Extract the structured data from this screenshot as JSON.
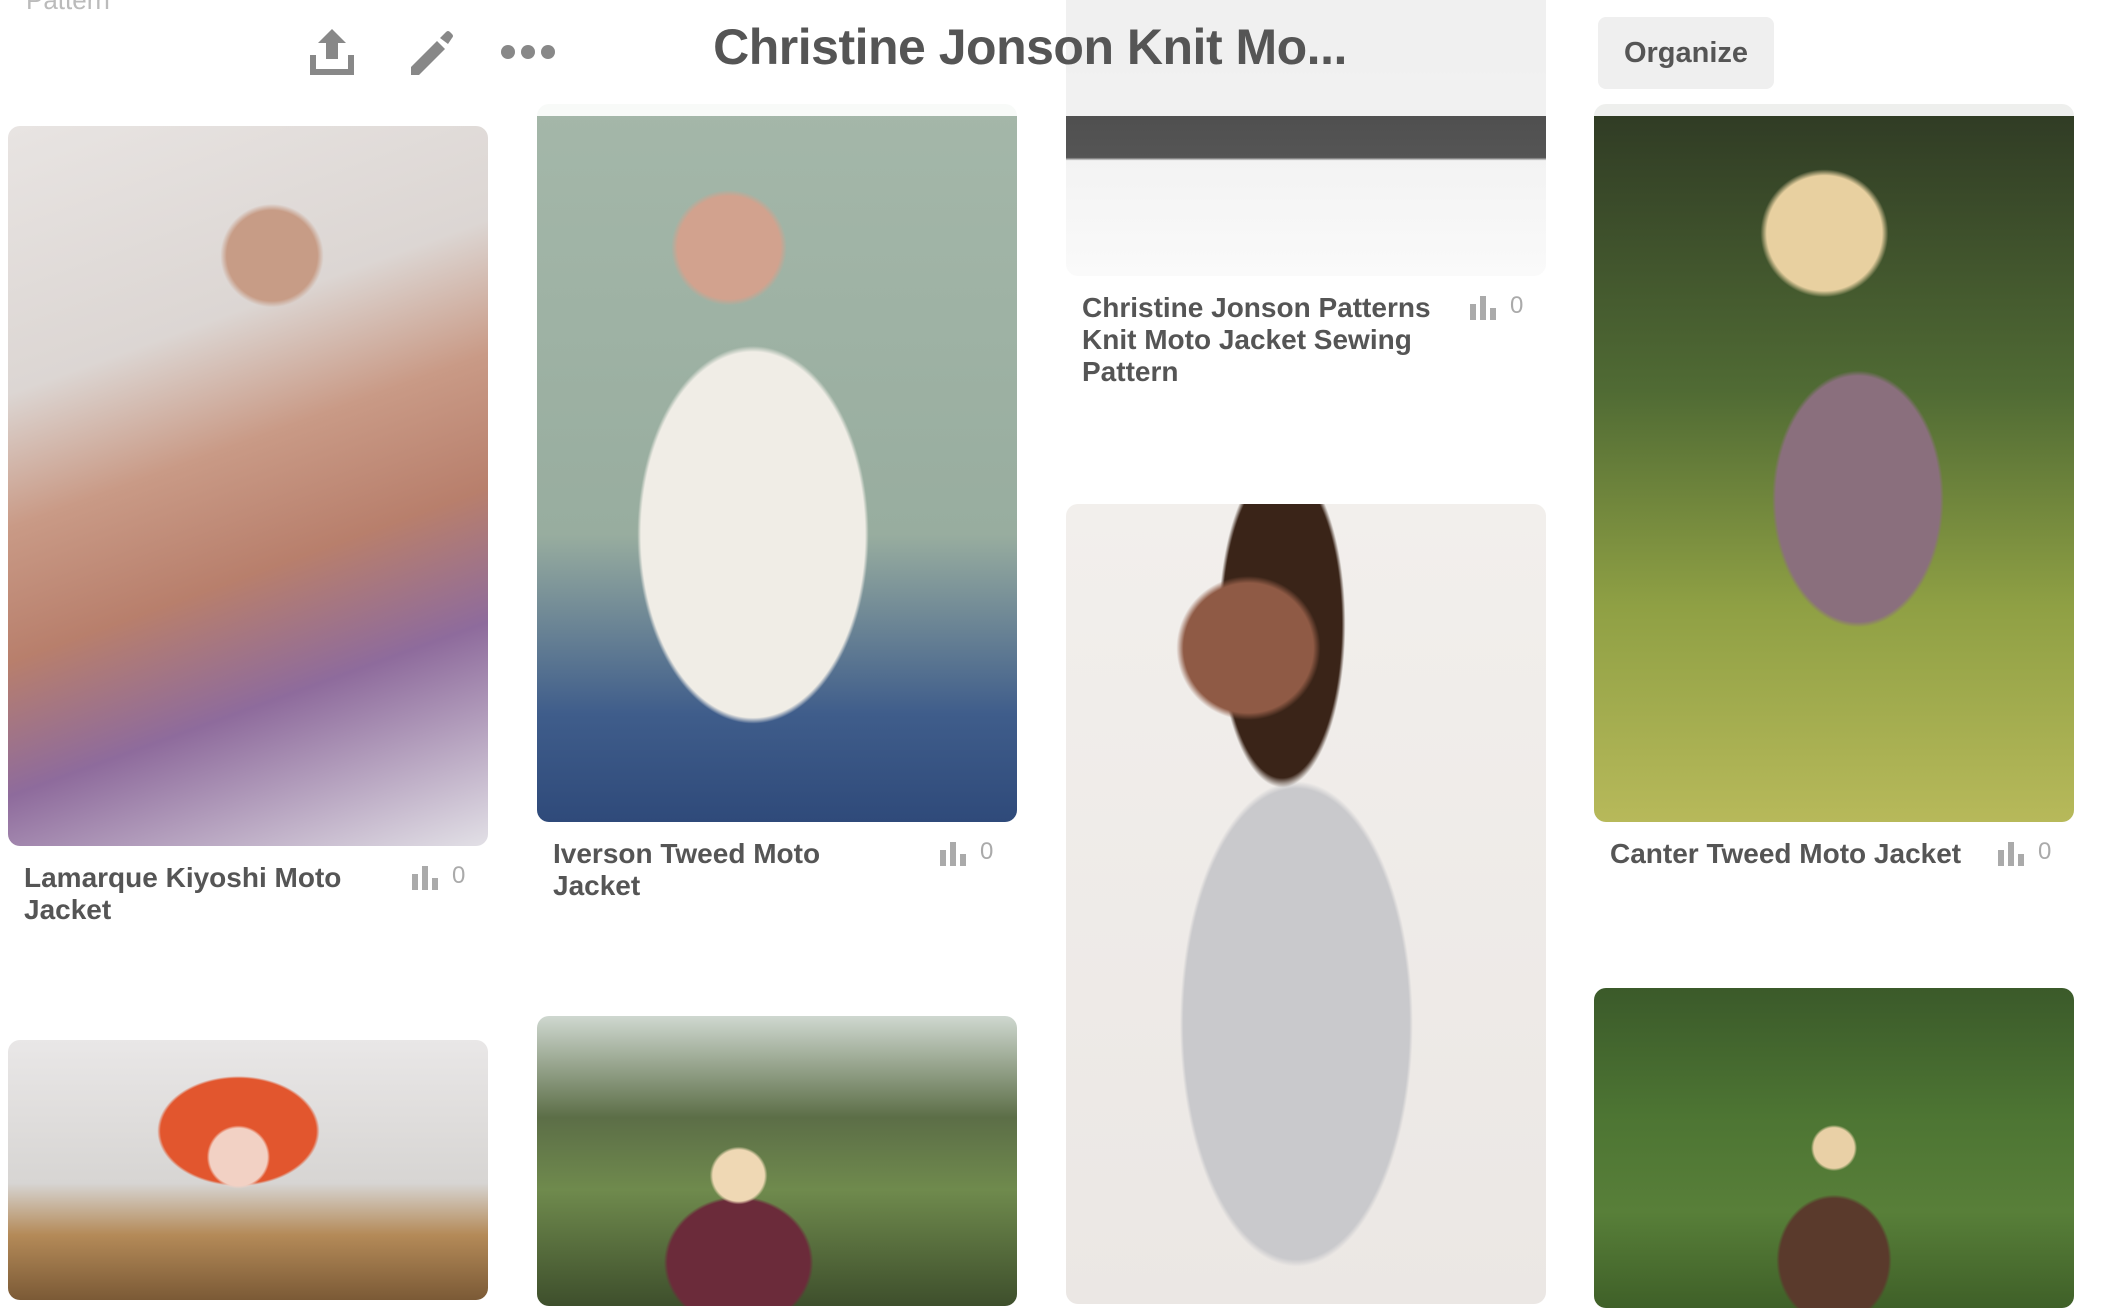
{
  "header": {
    "board_title": "Christine Jonson Knit Mo...",
    "organize_label": "Organize",
    "icons": [
      "share-icon",
      "edit-pencil-icon",
      "more-icon"
    ]
  },
  "top_partial_text": "Pattern",
  "pins": [
    {
      "title": "Lamarque Kiyoshi Moto Jacket",
      "count": "0"
    },
    {
      "title": "Iverson Tweed Moto Jacket",
      "count": "0"
    },
    {
      "title": "Christine Jonson Patterns Knit Moto Jacket Sewing Pattern",
      "count": "0"
    },
    {
      "title": "Canter Tweed Moto Jacket",
      "count": "0"
    }
  ],
  "colors": {
    "text": "#555555",
    "stat": "#aaaaaa",
    "button_bg": "#efefef"
  }
}
